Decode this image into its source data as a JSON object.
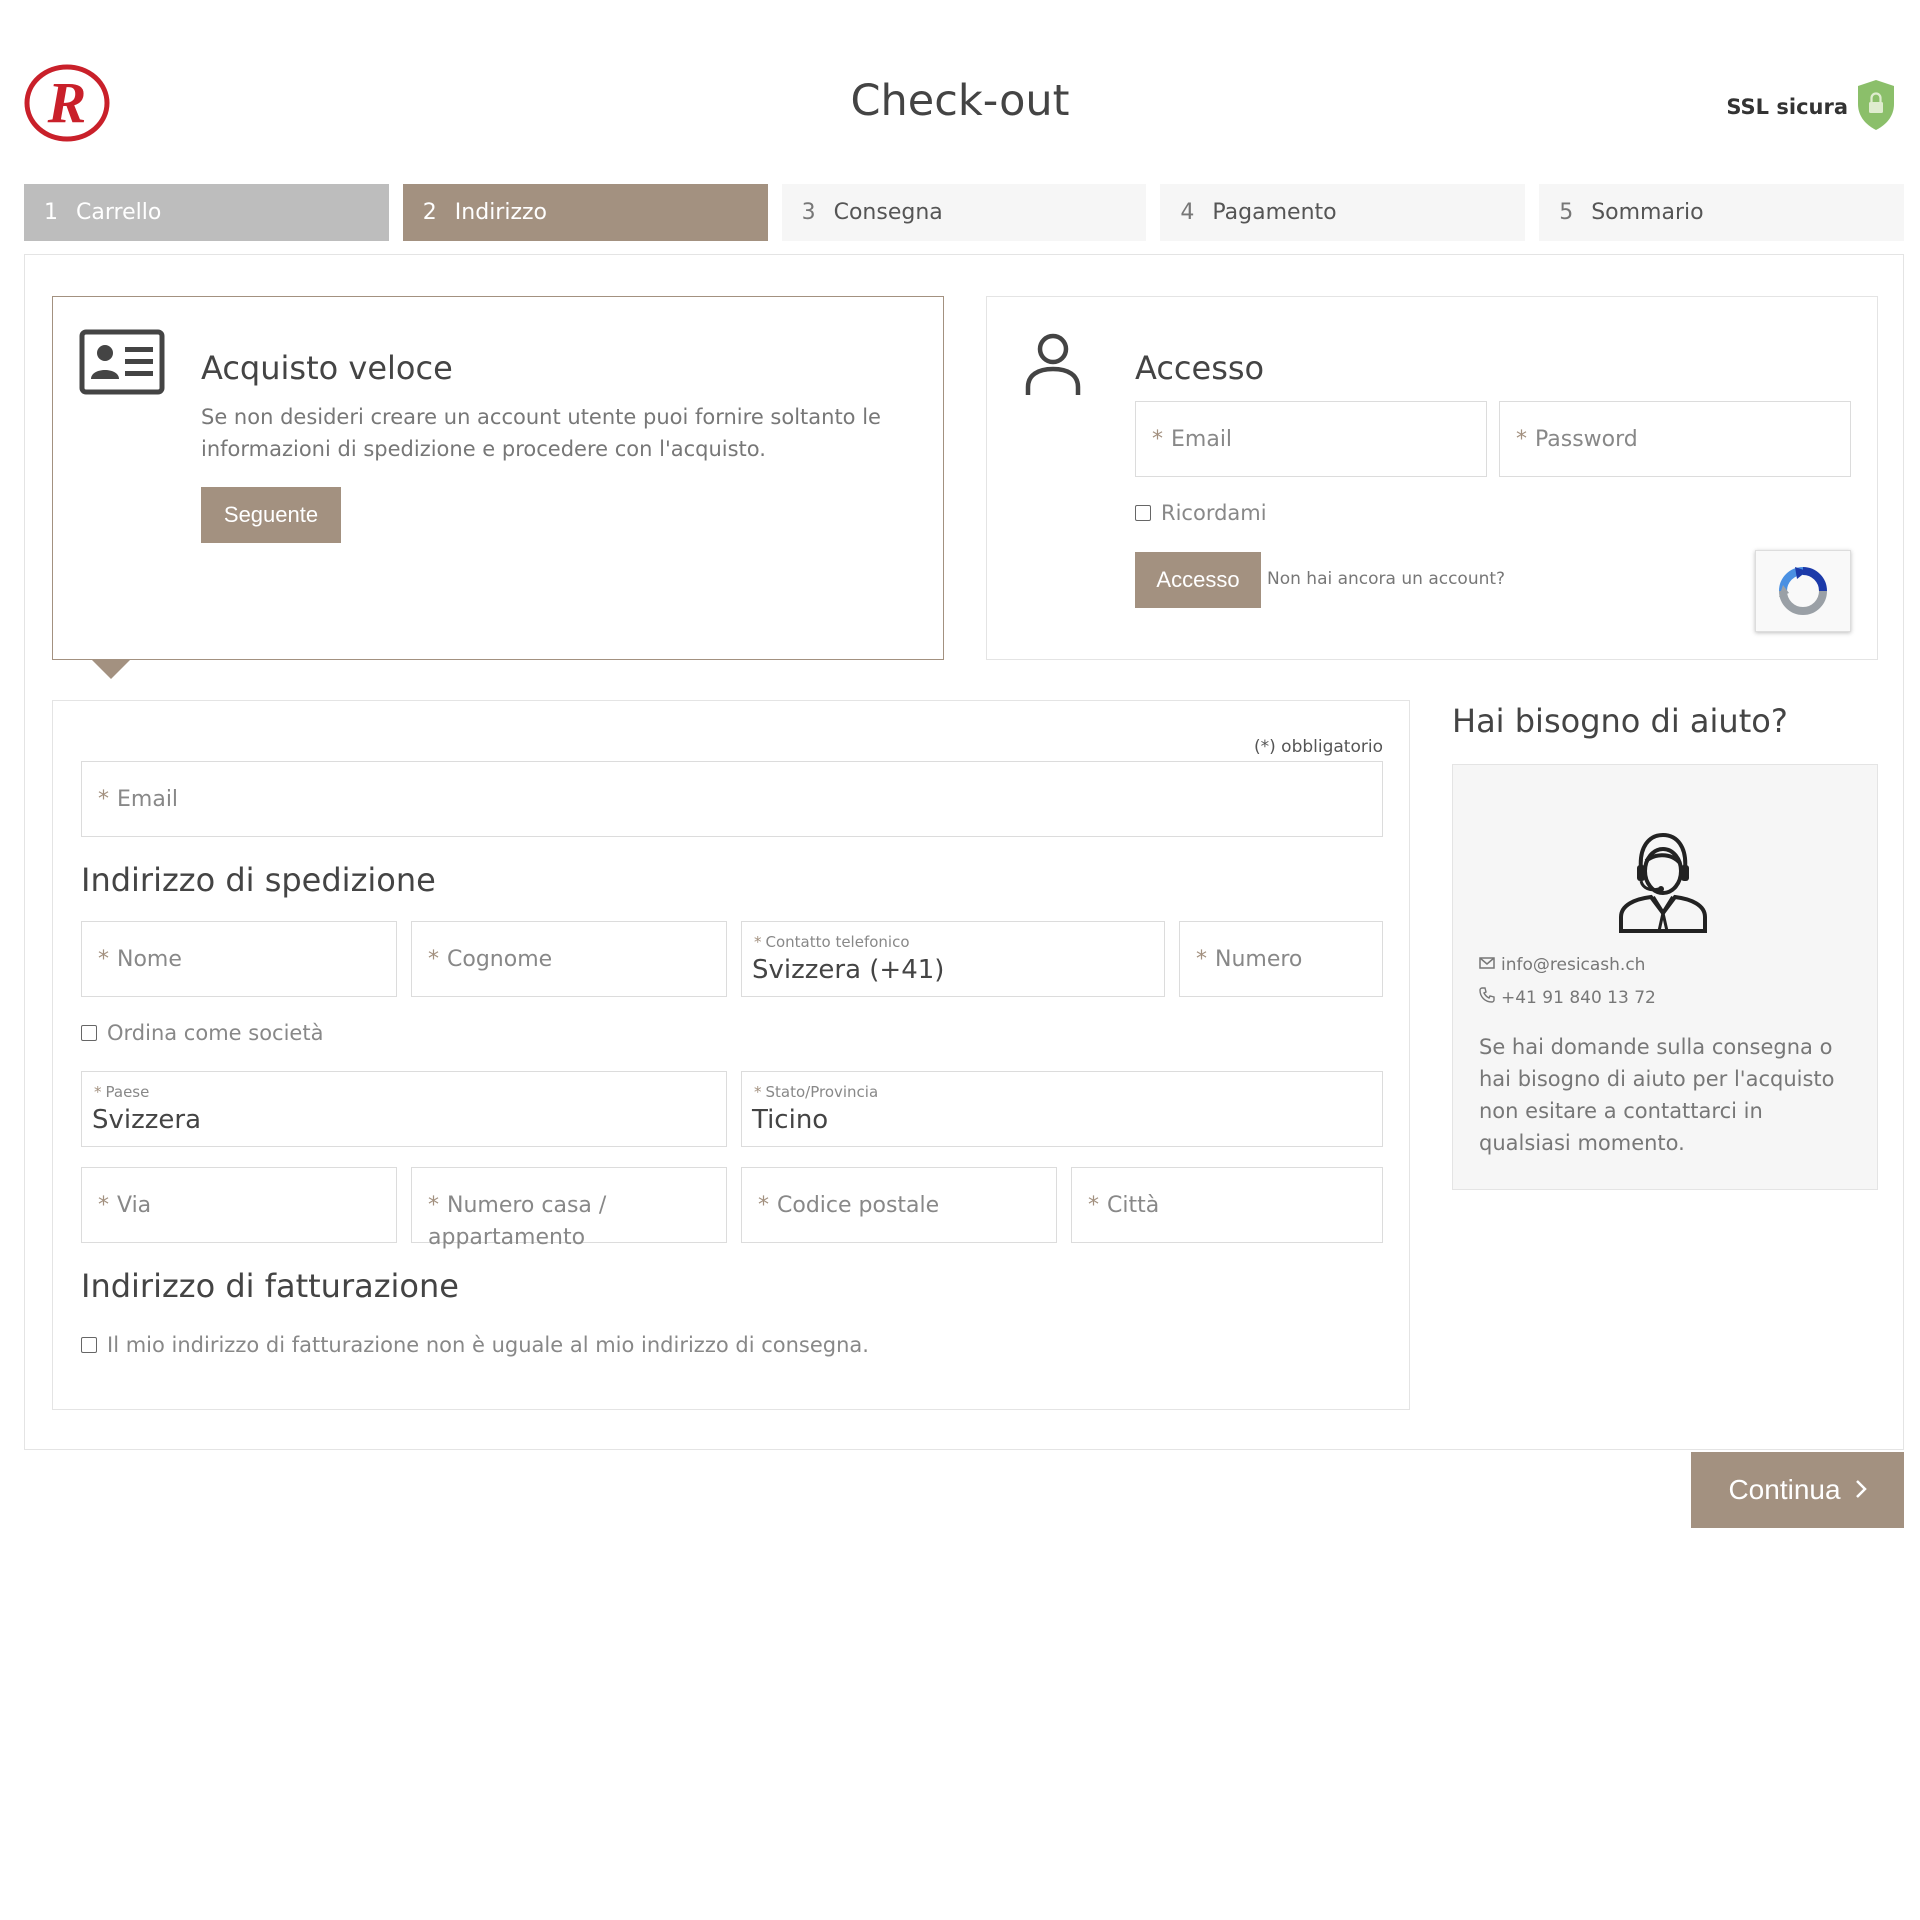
{
  "header": {
    "title": "Check-out",
    "ssl_label": "SSL sicura",
    "logo_icon": "resicash-logo-icon",
    "ssl_icon": "shield-lock-icon"
  },
  "steps": [
    {
      "num": "1",
      "label": "Carrello",
      "state": "done"
    },
    {
      "num": "2",
      "label": "Indirizzo",
      "state": "active"
    },
    {
      "num": "3",
      "label": "Consegna",
      "state": "upcoming"
    },
    {
      "num": "4",
      "label": "Pagamento",
      "state": "upcoming"
    },
    {
      "num": "5",
      "label": "Sommario",
      "state": "upcoming"
    }
  ],
  "quick": {
    "title": "Acquisto veloce",
    "description": "Se non desideri creare un account utente puoi fornire soltanto le informazioni di spedizione e procedere con l'acquisto.",
    "button": "Seguente",
    "icon": "id-card-icon"
  },
  "login": {
    "title": "Accesso",
    "email_placeholder": "Email",
    "password_placeholder": "Password",
    "remember": "Ricordami",
    "button": "Accesso",
    "no_account": "Non hai ancora un account?",
    "icon": "user-icon",
    "captcha_icon": "recaptcha-icon"
  },
  "form": {
    "required_note": "(*) obbligatorio",
    "email_placeholder": "Email",
    "shipping_title": "Indirizzo di spedizione",
    "nome": "Nome",
    "cognome": "Cognome",
    "contact_label": "Contatto telefonico",
    "contact_value": "Svizzera (+41)",
    "numero": "Numero",
    "company": "Ordina come società",
    "paese_label": "Paese",
    "paese_value": "Svizzera",
    "stato_label": "Stato/Provincia",
    "stato_value": "Ticino",
    "via": "Via",
    "casa": "Numero casa / appartamento",
    "cap": "Codice postale",
    "citta": "Città",
    "billing_title": "Indirizzo di fatturazione",
    "billing_checkbox": "Il mio indirizzo di fatturazione non è uguale al mio indirizzo di consegna."
  },
  "help": {
    "title": "Hai bisogno di aiuto?",
    "email": "info@resicash.ch",
    "phone": "+41 91 840 13 72",
    "text": "Se hai domande sulla consegna o hai bisogno di aiuto per l'acquisto non esitare a contattarci in qualsiasi momento.",
    "icon": "support-agent-icon"
  },
  "continue_button": "Continua",
  "colors": {
    "accent": "#a39180",
    "step_done": "#bdbdbd",
    "step_inactive": "#f6f6f6",
    "logo_red": "#c9202a",
    "shield_green": "#8bbf6a"
  }
}
